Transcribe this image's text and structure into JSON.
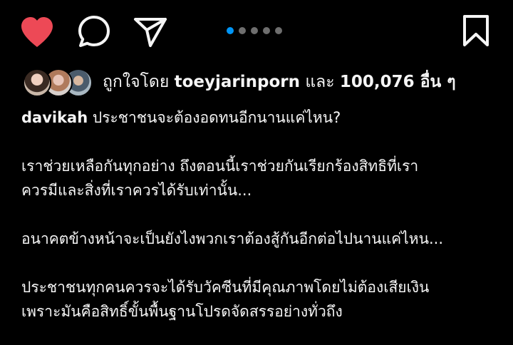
{
  "actions": {
    "like_icon": "heart-filled-icon",
    "comment_icon": "comment-bubble-icon",
    "share_icon": "paper-plane-icon",
    "save_icon": "bookmark-icon",
    "like_color": "#ed4956"
  },
  "carousel": {
    "total": 5,
    "active_index": 0,
    "active_color": "#0095f6"
  },
  "likes": {
    "prefix": "ถูกใจโดย",
    "first_user": "toeyjarinporn",
    "connector": "และ",
    "count": "100,076",
    "suffix": "อื่น ๆ"
  },
  "caption": {
    "username": "davikah",
    "lines": [
      "ประชาชนจะต้องอดทนอีกนานแค่ไหน?",
      "เราช่วยเหลือกันทุกอย่าง ถึงตอนนี้เราช่วยกันเรียกร้องสิทธิที่เรา",
      "ควรมีและสิ่งที่เราควรได้รับเท่านั้น...",
      "อนาคตข้างหน้าจะเป็นยังไงพวกเราต้องสู้กันอีกต่อไปนานแค่ไหน...",
      "ประชาชนทุกคนควรจะได้รับวัคซีนที่มีคุณภาพโดยไม่ต้องเสียเงิน",
      "เพราะมันคือสิทธิ์ขั้นพื้นฐานโปรดจัดสรรอย่างทั่วถึง"
    ]
  }
}
